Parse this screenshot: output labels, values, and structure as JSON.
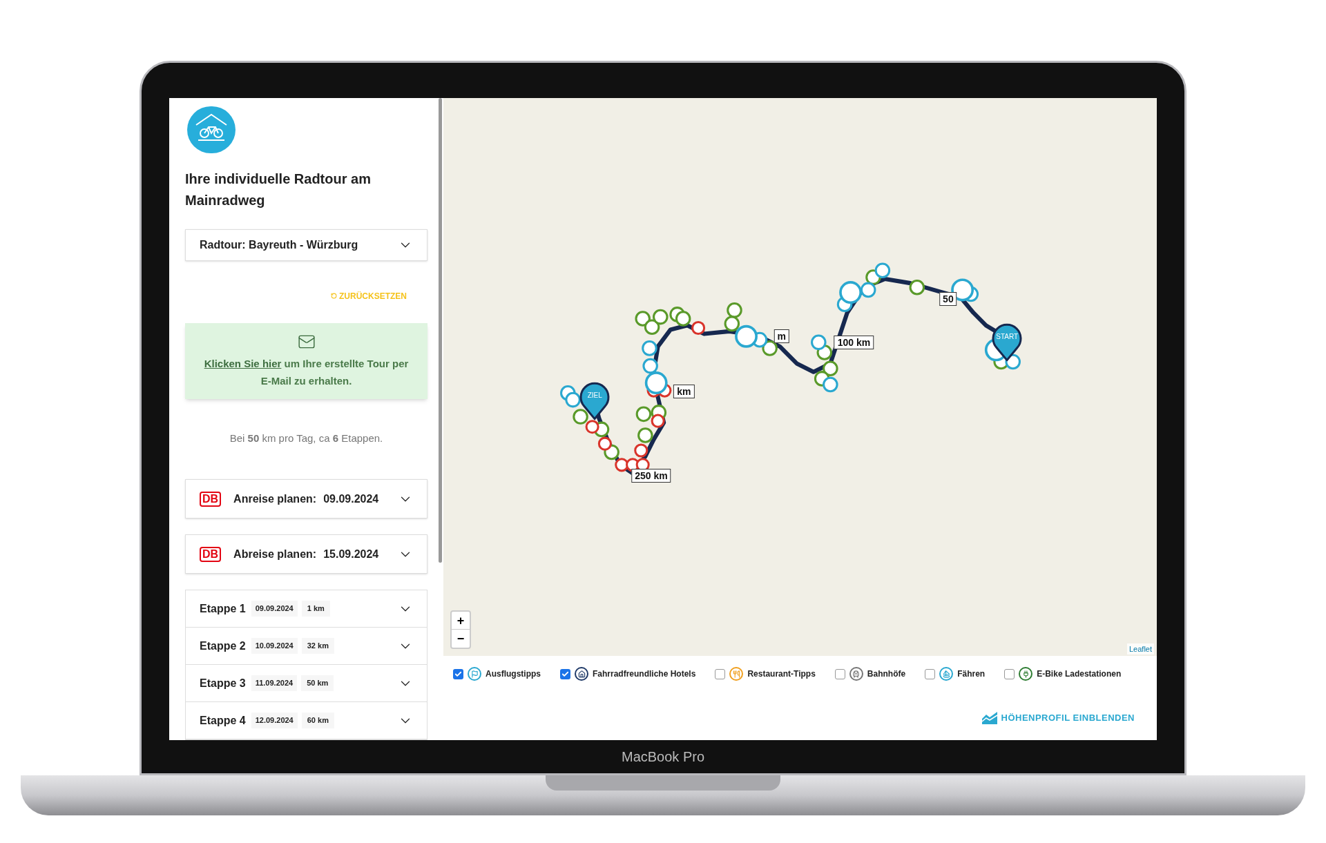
{
  "device": {
    "label": "MacBook Pro"
  },
  "sidebar": {
    "title": "Ihre individuelle Radtour am Mainradweg",
    "tour_select": {
      "value": "Radtour: Bayreuth - Würzburg"
    },
    "reset_button": "ZURÜCKSETZEN",
    "email_box": {
      "link": "Klicken Sie hier",
      "text": "um Ihre erstellte Tour per E-Mail zu erhalten."
    },
    "summary": "Bei **50** km pro Tag, ca **6** Etappen.",
    "travel": [
      {
        "logo_text": "DB",
        "label": "Anreise planen:",
        "date": "09.09.2024"
      },
      {
        "logo_text": "DB",
        "label": "Abreise planen:",
        "date": "15.09.2024"
      }
    ],
    "stages": [
      {
        "label": "Etappe 1",
        "date": "09.09.2024",
        "distance": "1 km"
      },
      {
        "label": "Etappe 2",
        "date": "10.09.2024",
        "distance": "32 km"
      },
      {
        "label": "Etappe 3",
        "date": "11.09.2024",
        "distance": "50 km"
      },
      {
        "label": "Etappe 4",
        "date": "12.09.2024",
        "distance": "60 km"
      }
    ]
  },
  "map": {
    "zoom_in": "+",
    "zoom_out": "−",
    "attribution": "Leaflet",
    "pins": [
      {
        "kind": "start",
        "text": "START"
      },
      {
        "kind": "end",
        "text": "ZIEL"
      }
    ],
    "distance_labels": [
      "50",
      "m",
      "100 km",
      "km",
      "250 km"
    ]
  },
  "legend": [
    {
      "kind": "tip",
      "label": "Ausflugstipps",
      "checked": true,
      "color": "#2aa8d0"
    },
    {
      "kind": "hotel",
      "label": "Fahrradfreundliche Hotels",
      "checked": true,
      "color": "#1f3a68"
    },
    {
      "kind": "restaurant",
      "label": "Restaurant-Tipps",
      "checked": false,
      "color": "#f0a020"
    },
    {
      "kind": "station",
      "label": "Bahnhöfe",
      "checked": false,
      "color": "#777777"
    },
    {
      "kind": "ferry",
      "label": "Fähren",
      "checked": false,
      "color": "#2aa8d0"
    },
    {
      "kind": "charging",
      "label": "E-Bike Ladestationen",
      "checked": false,
      "color": "#2e7d32"
    }
  ],
  "elevation_button": "HÖHENPROFIL EINBLENDEN"
}
